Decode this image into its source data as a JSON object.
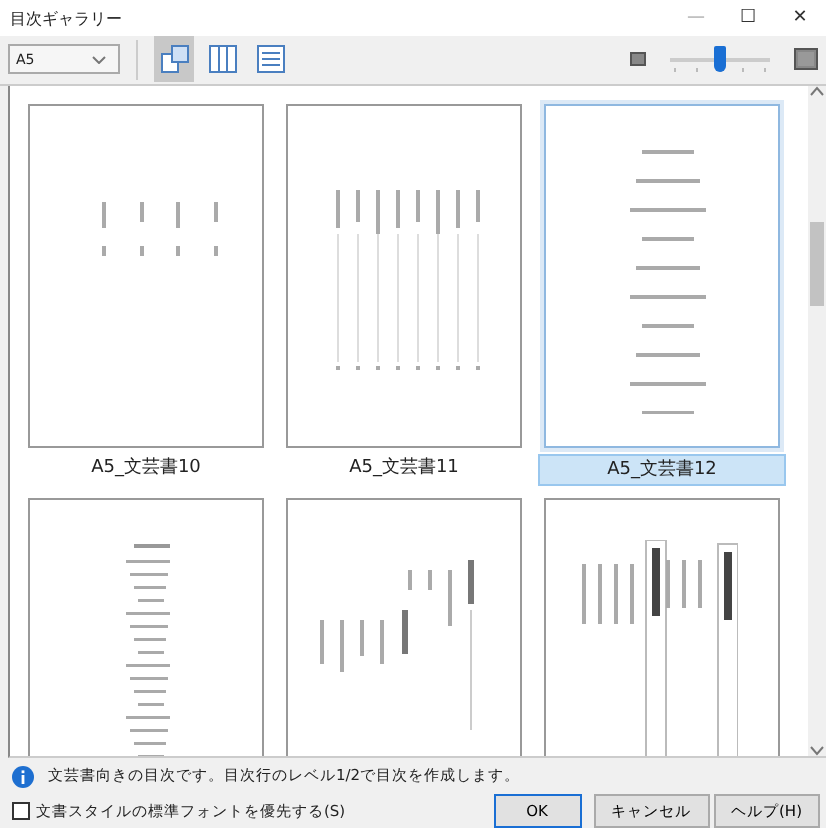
{
  "window": {
    "title": "目次ギャラリー",
    "controls": [
      "—",
      "☐",
      "✕"
    ]
  },
  "toolbar": {
    "size_select": {
      "value": "A5"
    },
    "view_buttons": [
      {
        "kind": "thumbnails",
        "selected": true
      },
      {
        "kind": "columns",
        "selected": false
      },
      {
        "kind": "rows",
        "selected": false
      }
    ],
    "zoom": {
      "level": 0.5
    }
  },
  "gallery": {
    "items": [
      {
        "label": "A5_文芸書10",
        "kind": "vertical-sparse",
        "selected": false
      },
      {
        "label": "A5_文芸書11",
        "kind": "vertical-lines",
        "selected": false
      },
      {
        "label": "A5_文芸書12",
        "kind": "centered-list",
        "selected": true
      },
      {
        "kind": "dense-list",
        "selected": false
      },
      {
        "kind": "vertical-headings",
        "selected": false
      },
      {
        "kind": "vertical-boxed",
        "selected": false
      }
    ]
  },
  "info": {
    "message": "文芸書向きの目次です。目次行のレベル1/2で目次を作成します。"
  },
  "option": {
    "label": "文書スタイルの標準フォントを優先する(S)",
    "checked": false
  },
  "buttons": [
    {
      "label": "OK",
      "default": true
    },
    {
      "label": "キャンセル",
      "default": false
    },
    {
      "label": "ヘルプ(H)",
      "default": false
    }
  ]
}
